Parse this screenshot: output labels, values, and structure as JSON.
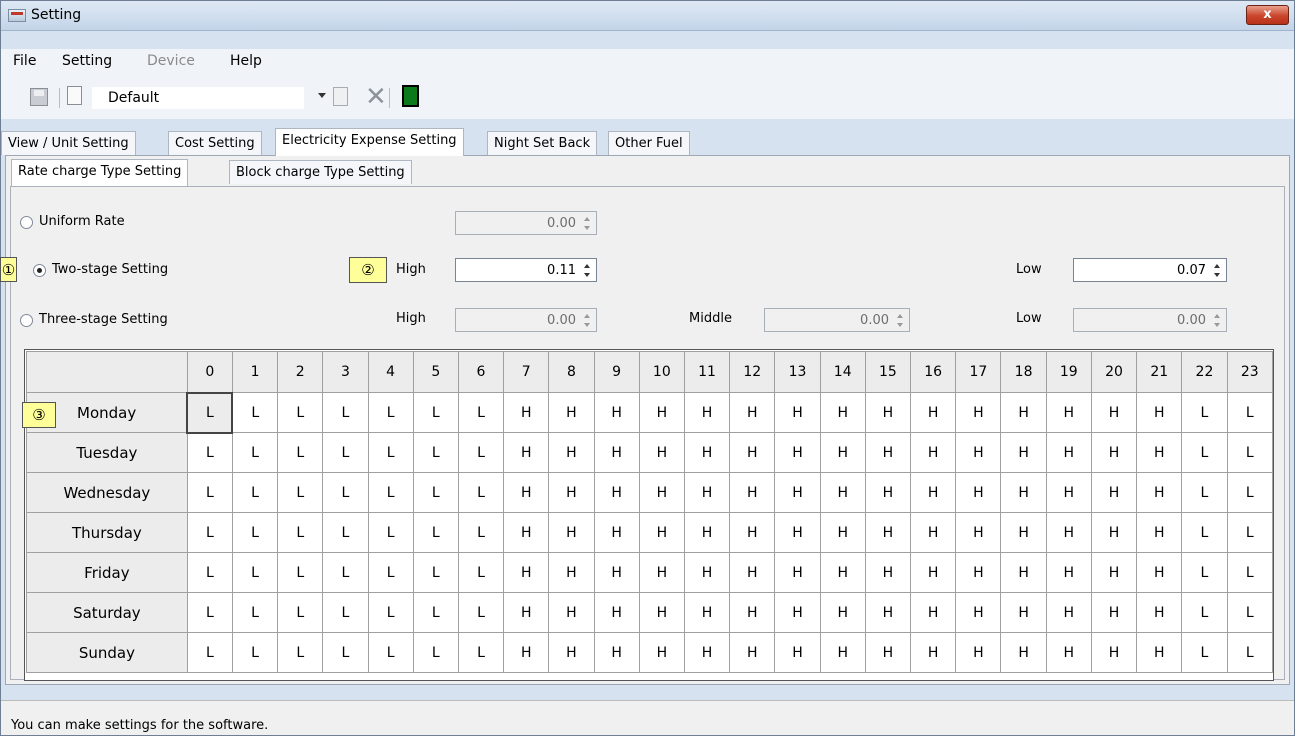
{
  "window": {
    "title": "Setting",
    "close": "x"
  },
  "menu": [
    "File",
    "Setting",
    "Device",
    "Help"
  ],
  "toolbar": {
    "profile": "Default"
  },
  "tabs": [
    "View / Unit Setting",
    "Cost Setting",
    "Electricity Expense Setting",
    "Night Set Back",
    "Other Fuel"
  ],
  "subtabs": [
    "Rate charge Type Setting",
    "Block charge Type Setting"
  ],
  "rates": {
    "uniform_label": "Uniform Rate",
    "uniform_value": "0.00",
    "two_label": "Two-stage Setting",
    "two_high_label": "High",
    "two_high_value": "0.11",
    "two_low_label": "Low",
    "two_low_value": "0.07",
    "three_label": "Three-stage Setting",
    "three_high_label": "High",
    "three_high_value": "0.00",
    "three_middle_label": "Middle",
    "three_middle_value": "0.00",
    "three_low_label": "Low",
    "three_low_value": "0.00"
  },
  "callouts": {
    "c1": "①",
    "c2": "②",
    "c3": "③"
  },
  "schedule": {
    "hours": [
      "0",
      "1",
      "2",
      "3",
      "4",
      "5",
      "6",
      "7",
      "8",
      "9",
      "10",
      "11",
      "12",
      "13",
      "14",
      "15",
      "16",
      "17",
      "18",
      "19",
      "20",
      "21",
      "22",
      "23"
    ],
    "rows": [
      {
        "day": "Monday",
        "cells": [
          "L",
          "L",
          "L",
          "L",
          "L",
          "L",
          "L",
          "H",
          "H",
          "H",
          "H",
          "H",
          "H",
          "H",
          "H",
          "H",
          "H",
          "H",
          "H",
          "H",
          "H",
          "H",
          "L",
          "L"
        ]
      },
      {
        "day": "Tuesday",
        "cells": [
          "L",
          "L",
          "L",
          "L",
          "L",
          "L",
          "L",
          "H",
          "H",
          "H",
          "H",
          "H",
          "H",
          "H",
          "H",
          "H",
          "H",
          "H",
          "H",
          "H",
          "H",
          "H",
          "L",
          "L"
        ]
      },
      {
        "day": "Wednesday",
        "cells": [
          "L",
          "L",
          "L",
          "L",
          "L",
          "L",
          "L",
          "H",
          "H",
          "H",
          "H",
          "H",
          "H",
          "H",
          "H",
          "H",
          "H",
          "H",
          "H",
          "H",
          "H",
          "H",
          "L",
          "L"
        ]
      },
      {
        "day": "Thursday",
        "cells": [
          "L",
          "L",
          "L",
          "L",
          "L",
          "L",
          "L",
          "H",
          "H",
          "H",
          "H",
          "H",
          "H",
          "H",
          "H",
          "H",
          "H",
          "H",
          "H",
          "H",
          "H",
          "H",
          "L",
          "L"
        ]
      },
      {
        "day": "Friday",
        "cells": [
          "L",
          "L",
          "L",
          "L",
          "L",
          "L",
          "L",
          "H",
          "H",
          "H",
          "H",
          "H",
          "H",
          "H",
          "H",
          "H",
          "H",
          "H",
          "H",
          "H",
          "H",
          "H",
          "L",
          "L"
        ]
      },
      {
        "day": "Saturday",
        "cells": [
          "L",
          "L",
          "L",
          "L",
          "L",
          "L",
          "L",
          "H",
          "H",
          "H",
          "H",
          "H",
          "H",
          "H",
          "H",
          "H",
          "H",
          "H",
          "H",
          "H",
          "H",
          "H",
          "L",
          "L"
        ]
      },
      {
        "day": "Sunday",
        "cells": [
          "L",
          "L",
          "L",
          "L",
          "L",
          "L",
          "L",
          "H",
          "H",
          "H",
          "H",
          "H",
          "H",
          "H",
          "H",
          "H",
          "H",
          "H",
          "H",
          "H",
          "H",
          "H",
          "L",
          "L"
        ]
      }
    ]
  },
  "status": "You can make settings for the software."
}
